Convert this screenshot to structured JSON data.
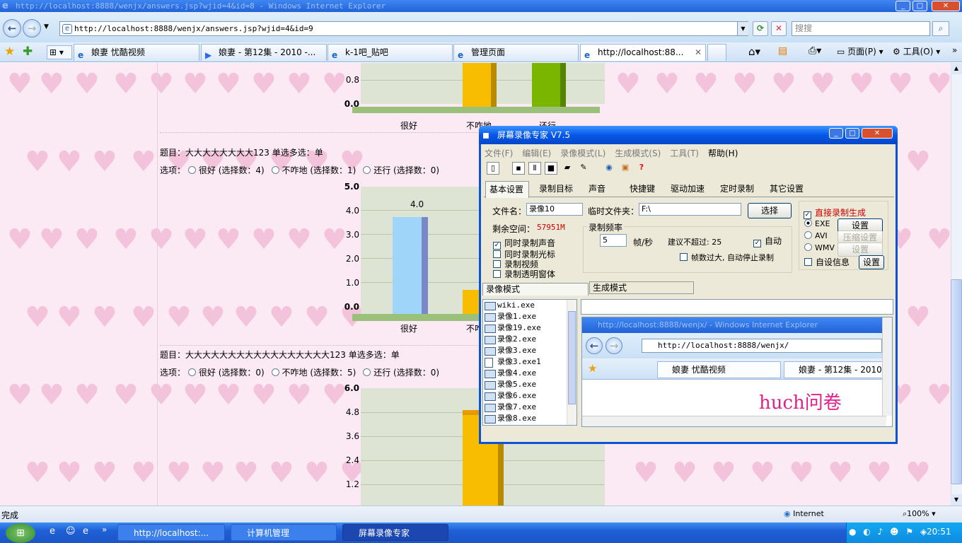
{
  "browser": {
    "title": "http://localhost:8888/wenjx/answers.jsp?wjid=4&id=8 - Windows Internet Explorer",
    "address": "http://localhost:8888/wenjx/answers.jsp?wjid=4&id=9",
    "search_placeholder": "搜搜",
    "tabs": [
      {
        "label": "娘妻 忧酷视频"
      },
      {
        "label": "娘妻 - 第12集 - 2010 -..."
      },
      {
        "label": "k-1吧_贴吧"
      },
      {
        "label": "管理页面"
      },
      {
        "label": "http://localhost:88..."
      }
    ],
    "toolbar": {
      "page": "页面(P)",
      "tools": "工具(O)"
    }
  },
  "page": {
    "chart1": {
      "labels": [
        "很好",
        "不咋地",
        "还行"
      ],
      "ticks": [
        "0.8",
        "0.0"
      ]
    },
    "question2": {
      "title": "题目：大大大大大大大大123 单选多选：单",
      "options_label": "选项：",
      "options": [
        {
          "label": "很好",
          "count": "(选择数：4)"
        },
        {
          "label": "不咋地",
          "count": "(选择数：1)"
        },
        {
          "label": "还行",
          "count": "(选择数：0)"
        }
      ]
    },
    "chart2": {
      "ticks": [
        "5.0",
        "4.0",
        "3.0",
        "2.0",
        "1.0",
        "0.0"
      ],
      "value_label": "4.0",
      "labels": [
        "很好",
        "不咋"
      ]
    },
    "question3": {
      "title": "题目：大大大大大大大大大大大大大大大大大123 单选多选：单",
      "options_label": "选项：",
      "options": [
        {
          "label": "很好",
          "count": "(选择数：0)"
        },
        {
          "label": "不咋地",
          "count": "(选择数：5)"
        },
        {
          "label": "还行",
          "count": "(选择数：0)"
        }
      ]
    },
    "chart3": {
      "ticks": [
        "6.0",
        "4.8",
        "3.6",
        "2.4",
        "1.2"
      ]
    }
  },
  "chart_data": [
    {
      "type": "bar",
      "categories": [
        "很好",
        "不咋地",
        "还行"
      ],
      "values": [
        4,
        1,
        0
      ],
      "ylim": [
        0,
        5
      ]
    },
    {
      "type": "bar",
      "categories": [
        "很好",
        "不咋地",
        "还行"
      ],
      "values": [
        0,
        5,
        0
      ],
      "ylim": [
        0,
        6
      ]
    }
  ],
  "status": {
    "left": "完成",
    "zone": "Internet",
    "zoom": "100%"
  },
  "taskbar": {
    "buttons": [
      "http://localhost:...",
      "计算机管理",
      "屏幕录像专家"
    ],
    "clock": "20:51"
  },
  "recorder": {
    "title": "屏幕录像专家 V7.5",
    "menu": [
      "文件(F)",
      "编辑(E)",
      "录像模式(L)",
      "生成模式(S)",
      "工具(T)",
      "帮助(H)"
    ],
    "tabs": [
      "基本设置",
      "录制目标",
      "声音",
      "快捷键",
      "驱动加速",
      "定时录制",
      "其它设置"
    ],
    "filename_label": "文件名：",
    "filename": "录像10",
    "tempdir_label": "临时文件夹：",
    "tempdir": "F:\\",
    "select_btn": "选择",
    "space_label": "剩余空间：",
    "space": "57951M",
    "checks": [
      "同时录制声音",
      "同时录制光标",
      "录制视频",
      "录制透明窗体"
    ],
    "freq_title": "录制频率",
    "fps": "5",
    "fps_unit": "帧/秒",
    "suggest": "建议不超过: 25",
    "auto": "自动",
    "auto_stop": "帧数过大, 自动停止录制",
    "direct": "直接录制生成",
    "formats": [
      "EXE",
      "AVI",
      "WMV"
    ],
    "set_btn": "设置",
    "compress_btn": "压缩设置",
    "custom_info": "自设信息",
    "mode_tabs": [
      "录像模式",
      "生成模式"
    ],
    "files": [
      "wiki.exe",
      "录像1.exe",
      "录像19.exe",
      "录像2.exe",
      "录像3.exe",
      "录像3.exe1",
      "录像4.exe",
      "录像5.exe",
      "录像6.exe",
      "录像7.exe",
      "录像8.exe"
    ],
    "preview": {
      "title": "http://localhost:8888/wenjx/ - Windows Internet Explorer",
      "address": "http://localhost:8888/wenjx/",
      "tab1": "娘妻 忧酷视频",
      "tab2": "娘妻 - 第12集 - 2010",
      "heading": "huch问卷"
    }
  }
}
